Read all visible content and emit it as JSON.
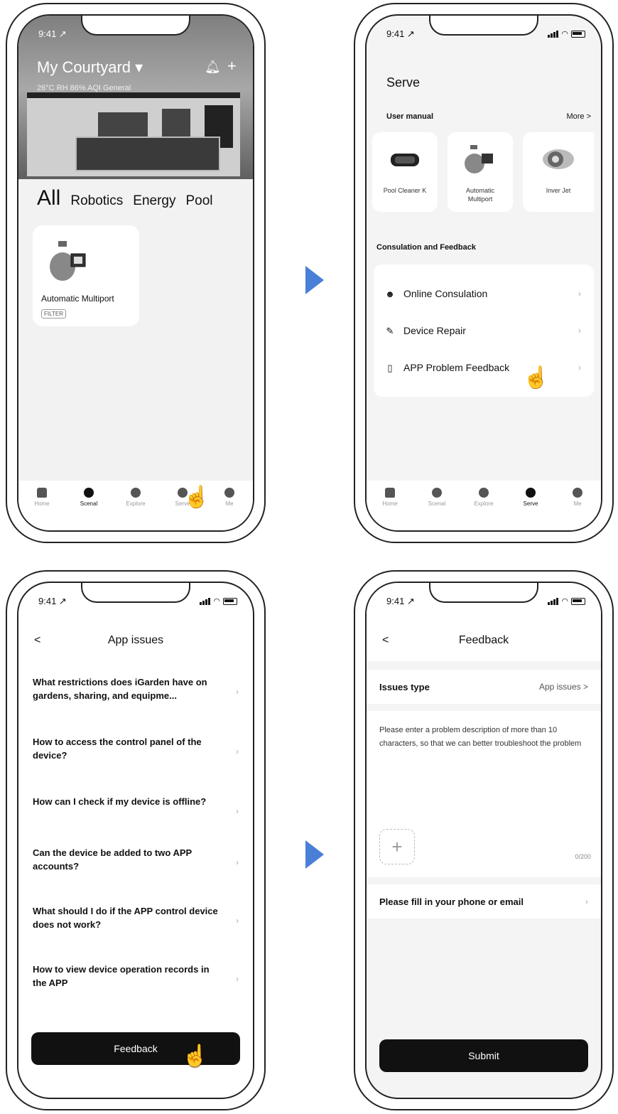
{
  "status": {
    "time": "9:41 ↗"
  },
  "phone1": {
    "courtyard": "My Courtyard ▾",
    "weather": "26°C  RH 86%  AQI General",
    "categories": [
      "All",
      "Robotics",
      "Energy",
      "Pool"
    ],
    "device": {
      "name": "Automatic Multiport",
      "tag": "FILTER"
    },
    "tabs": [
      "Home",
      "Scenal",
      "Explore",
      "Serve",
      "Me"
    ]
  },
  "phone2": {
    "title": "Serve",
    "user_manual": "User manual",
    "more": "More >",
    "manuals": [
      "Pool Cleaner K",
      "Automatic Multiport",
      "Inver Jet"
    ],
    "consult_head": "Consulation and Feedback",
    "menu": [
      "Online Consulation",
      "Device Repair",
      "APP Problem Feedback"
    ],
    "tabs": [
      "Home",
      "Scenal",
      "Explore",
      "Serve",
      "Me"
    ]
  },
  "phone3": {
    "back": "<",
    "title": "App issues",
    "faqs": [
      "What restrictions does iGarden have on gardens, sharing, and equipme...",
      "How to access the control panel of the device?",
      "How can I check if my device is offline?",
      "Can the device be added to two APP accounts?",
      "What should I do if the APP control device does not work?",
      "How to view device operation records in the APP"
    ],
    "button": "Feedback"
  },
  "phone4": {
    "back": "<",
    "title": "Feedback",
    "issues_label": "Issues type",
    "issues_value": "App issues >",
    "placeholder": "Please enter a problem description of more than 10 characters, so that we can better troubleshoot the problem",
    "counter": "0/200",
    "contact": "Please fill in your phone or email",
    "button": "Submit"
  },
  "colors": {
    "arrow": "#4a7fd8",
    "button": "#111111"
  },
  "icons": [
    "bell-icon",
    "plus-icon",
    "home-icon",
    "scenal-icon",
    "explore-icon",
    "serve-heart-icon",
    "me-icon",
    "hand-pointer-icon",
    "chevron-right-icon",
    "back-icon"
  ]
}
